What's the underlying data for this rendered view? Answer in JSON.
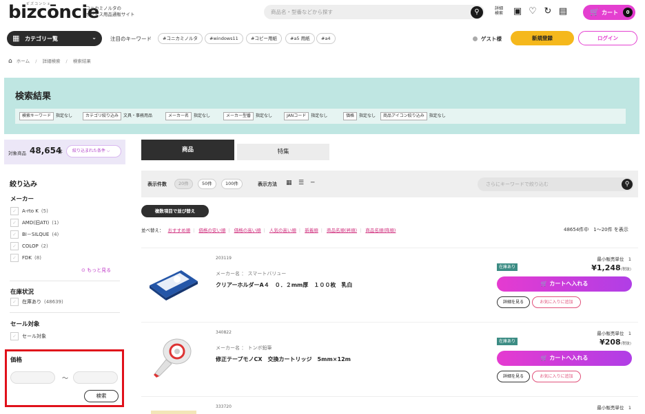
{
  "header": {
    "logo_ruby": "ビズコンシェ",
    "logo": "bizcōncie",
    "tagline_line1": "コニカミノルタの",
    "tagline_line2": "オフィス用品通販サイト",
    "search_placeholder": "商品名・型番などから探す",
    "detail_search_line1": "詳細",
    "detail_search_line2": "検索",
    "cart_label": "カート",
    "cart_count": "0"
  },
  "nav": {
    "category_label": "カテゴリー覧",
    "keyword_label": "注目のキーワード",
    "keywords": [
      "#コニカミノルタ",
      "#windows11",
      "#コピー用紙",
      "#a5 用紙",
      "#a4"
    ],
    "guest_label": "ゲスト様",
    "register_label": "新規登録",
    "login_label": "ログイン"
  },
  "breadcrumb": [
    "ホーム",
    "詳細検索",
    "検索結果"
  ],
  "banner": {
    "title": "検索結果",
    "conditions": [
      {
        "key": "検索キーワード",
        "value": "指定なし"
      },
      {
        "key": "カテゴリ絞り込み",
        "value": "文具・事務用品"
      },
      {
        "key": "メーカー名",
        "value": "指定なし"
      },
      {
        "key": "メーカー型番",
        "value": "指定なし"
      },
      {
        "key": "JANコード",
        "value": "指定なし"
      },
      {
        "key": "価格",
        "value": "指定なし"
      },
      {
        "key": "商品アイコン絞り込み",
        "value": "指定なし"
      }
    ]
  },
  "count": {
    "label": "対象商品",
    "value": "48,654",
    "unit": "件",
    "narrow_label": "絞り込まれた条件 ⌵"
  },
  "sidebar": {
    "title": "絞り込み",
    "maker_heading": "メーカー",
    "makers": [
      {
        "name": "A-rto K",
        "count": "(5)"
      },
      {
        "name": "AMD(旧ATI)",
        "count": "(1)"
      },
      {
        "name": "BI－SILQUE",
        "count": "(4)"
      },
      {
        "name": "COLOP",
        "count": "(2)"
      },
      {
        "name": "FDK",
        "count": "(8)"
      }
    ],
    "more_label": "⊙ もっと見る",
    "stock_heading": "在庫状況",
    "stock_item": {
      "name": "在庫あり",
      "count": "(48639)"
    },
    "sale_heading": "セール対象",
    "sale_item": {
      "name": "セール対象"
    },
    "price_heading": "価格",
    "price_tilde": "〜",
    "price_search": "検索"
  },
  "tabs": {
    "products": "商品",
    "features": "特集"
  },
  "toolbar": {
    "per_page_label": "表示件数",
    "per_page": [
      "20件",
      "50件",
      "100件"
    ],
    "view_label": "表示方法",
    "search_placeholder": "さらにキーワードで絞り込む"
  },
  "multi_sort_label": "複数項目で並び替え",
  "sort": {
    "label": "並べ替え：",
    "options": [
      "おすすめ順",
      "価格の安い順",
      "価格の高い順",
      "人気の高い順",
      "新着順",
      "商品名順(昇順)",
      "商品名順(降順)"
    ],
    "pager": "48654件中　1〜20件 を表示"
  },
  "products": [
    {
      "code": "203119",
      "maker": "メーカー名 ： スマートバリュー",
      "name": "クリアーホルダーA４　０．２mm厚　１００枚　乳白",
      "stock": "在庫あり",
      "min_unit": "最小販売単位　1",
      "price": "¥1,248",
      "tax": "(税抜)",
      "cart_label": "カートへ入れる",
      "detail_label": "詳細を見る",
      "fav_label": "お気に入りに追加"
    },
    {
      "code": "340822",
      "maker": "メーカー名 ： トンボ鉛筆",
      "name": "修正テープモノCX　交換カートリッジ　5mm×12m",
      "stock": "在庫あり",
      "min_unit": "最小販売単位　1",
      "price": "¥208",
      "tax": "(税抜)",
      "cart_label": "カートへ入れる",
      "detail_label": "詳細を見る",
      "fav_label": "お気に入りに追加"
    },
    {
      "code": "333720",
      "min_unit": "最小販売単位　1"
    }
  ],
  "colors": {
    "accent": "#e43fd0",
    "banner": "#bfe6e2",
    "register": "#f5b81c",
    "highlight": "#e0101a"
  }
}
